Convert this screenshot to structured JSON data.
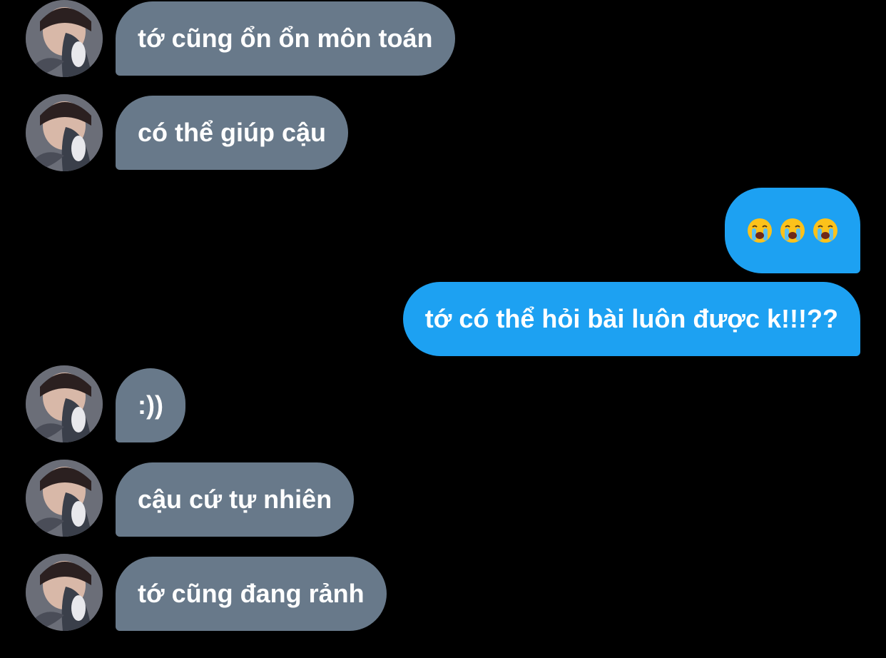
{
  "conversation": {
    "messages": [
      {
        "id": "m1",
        "direction": "incoming",
        "text": "tớ cũng ổn ổn môn toán"
      },
      {
        "id": "m2",
        "direction": "incoming",
        "text": "có thể giúp cậu"
      },
      {
        "id": "m3",
        "direction": "outgoing",
        "emoji": [
          "loudly-crying-face",
          "loudly-crying-face",
          "loudly-crying-face"
        ]
      },
      {
        "id": "m4",
        "direction": "outgoing",
        "text": "tớ có thể hỏi bài luôn được k!!!??"
      },
      {
        "id": "m5",
        "direction": "incoming",
        "text": ":))"
      },
      {
        "id": "m6",
        "direction": "incoming",
        "text": "cậu cứ tự nhiên"
      },
      {
        "id": "m7",
        "direction": "incoming",
        "text": "tớ cũng đang rảnh"
      }
    ]
  },
  "colors": {
    "background": "#000000",
    "incoming_bubble": "#68798a",
    "outgoing_bubble": "#1da1f2",
    "text": "#ffffff"
  },
  "icons": {
    "avatar": "contact-avatar-photo",
    "emoji": "loudly-crying-face-icon"
  }
}
